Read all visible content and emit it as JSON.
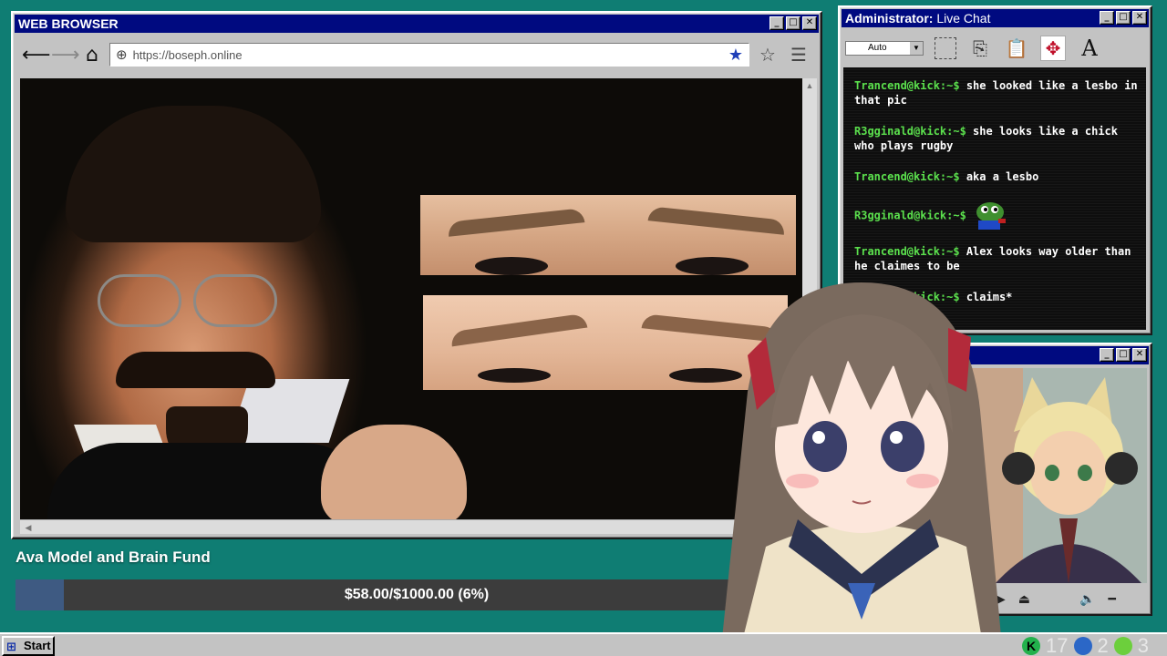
{
  "browser": {
    "title": "WEB BROWSER",
    "url": "https://boseph.online",
    "controls": {
      "minimize": "_",
      "maximize": "□",
      "close": "✕"
    }
  },
  "chat": {
    "title_bold": "Administrator:",
    "title_rest": " Live Chat",
    "zoom_select": "Auto",
    "messages": [
      {
        "user": "Trancend@kick:~$",
        "text": " she looked like a lesbo in that pic"
      },
      {
        "user": "R3gginald@kick:~$",
        "text": " she looks like a chick who plays rugby"
      },
      {
        "user": "Trancend@kick:~$",
        "text": " aka a lesbo"
      },
      {
        "user": "R3gginald@kick:~$",
        "text": ""
      },
      {
        "user": "Trancend@kick:~$",
        "text": " Alex looks way older than he claimes to be"
      },
      {
        "user": "Trancend@kick:~$",
        "text": " claims*"
      }
    ],
    "icons": [
      "select-icon",
      "copy-icon",
      "paste-icon",
      "move-icon",
      "font-icon"
    ]
  },
  "fund": {
    "title": "Ava Model and Brain Fund",
    "progress_text": "$58.00/$1000.00 (6%)",
    "raised": 58,
    "goal": 1000,
    "percent": 6,
    "fill_color": "#3e5a82"
  },
  "taskbar": {
    "start_label": "Start",
    "tray": {
      "kick_count": "17",
      "moon_count": "2",
      "play_count": "3"
    }
  },
  "colors": {
    "desktop": "#0f7d73",
    "titlebar": "#000a80",
    "chat_user": "#5be04d"
  }
}
